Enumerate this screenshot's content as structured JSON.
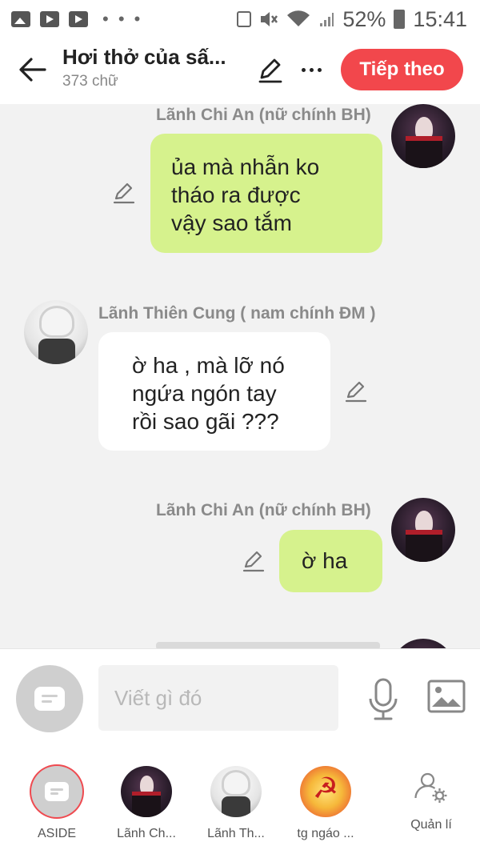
{
  "status_bar": {
    "left_icons": [
      "gallery-icon",
      "video-icon",
      "youtube-icon",
      "more-dots-icon"
    ],
    "right_icons": [
      "battery-saver-icon",
      "mute-icon",
      "wifi-icon",
      "signal-icon",
      "battery-icon"
    ],
    "battery": "52%",
    "time": "15:41"
  },
  "header": {
    "title": "Hơi thở của sấ...",
    "word_count": "373 chữ",
    "next_label": "Tiếp theo"
  },
  "messages": [
    {
      "sender": "Lãnh Chi An (nữ chính BH)",
      "lines": [
        "ủa mà nhẫn ko",
        "tháo ra được",
        "vậy sao tắm"
      ],
      "side": "right",
      "bubble_color": "#d6f28d"
    },
    {
      "sender": "Lãnh Thiên Cung ( nam chính ĐM )",
      "lines": [
        "ờ ha , mà lỡ nó",
        "ngứa ngón tay",
        "rồi sao gãi ???"
      ],
      "side": "left",
      "bubble_color": "#ffffff"
    },
    {
      "sender": "Lãnh Chi An (nữ chính BH)",
      "lines": [
        "ờ ha"
      ],
      "side": "right",
      "bubble_color": "#d6f28d"
    }
  ],
  "composer": {
    "placeholder": "Viết gì đó"
  },
  "characters": [
    {
      "name": "ASIDE"
    },
    {
      "name": "Lãnh Ch..."
    },
    {
      "name": "Lãnh Th..."
    },
    {
      "name": "tg ngáo ..."
    },
    {
      "name": "Quản lí"
    }
  ],
  "colors": {
    "accent": "#f2474c",
    "bubble_self": "#d6f28d",
    "background": "#f2f2f2"
  }
}
